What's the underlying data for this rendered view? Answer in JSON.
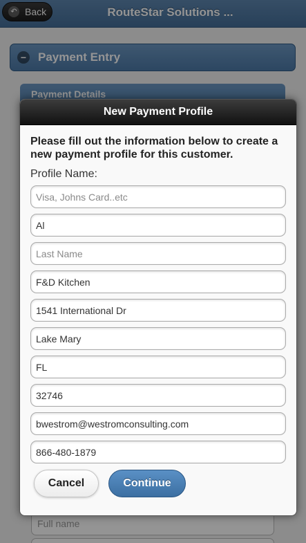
{
  "header": {
    "back_label": "Back",
    "title": "RouteStar Solutions ..."
  },
  "background": {
    "section_title": "Payment Entry",
    "sub_section_title": "Payment Details",
    "bottom_field_placeholder": "Full name"
  },
  "dialog": {
    "title": "New Payment Profile",
    "intro": "Please fill out the information below to create a new payment profile for this customer.",
    "profile_name_label": "Profile Name:",
    "fields": {
      "profile_name": {
        "value": "",
        "placeholder": "Visa, Johns Card..etc"
      },
      "first_name": {
        "value": "Al",
        "placeholder": ""
      },
      "last_name": {
        "value": "",
        "placeholder": "Last Name"
      },
      "company": {
        "value": "F&D Kitchen",
        "placeholder": ""
      },
      "address": {
        "value": "1541 International Dr",
        "placeholder": ""
      },
      "city": {
        "value": "Lake Mary",
        "placeholder": ""
      },
      "state": {
        "value": "FL",
        "placeholder": ""
      },
      "zip": {
        "value": "32746",
        "placeholder": ""
      },
      "email": {
        "value": "bwestrom@westromconsulting.com",
        "placeholder": ""
      },
      "phone": {
        "value": "866-480-1879",
        "placeholder": ""
      }
    },
    "cancel_label": "Cancel",
    "continue_label": "Continue"
  },
  "icons": {
    "back": "back-arrow-icon",
    "collapse": "minus-icon"
  },
  "colors": {
    "header": "#4f79a4",
    "dialog_header": "#222222",
    "primary_button": "#4a7fb4"
  }
}
